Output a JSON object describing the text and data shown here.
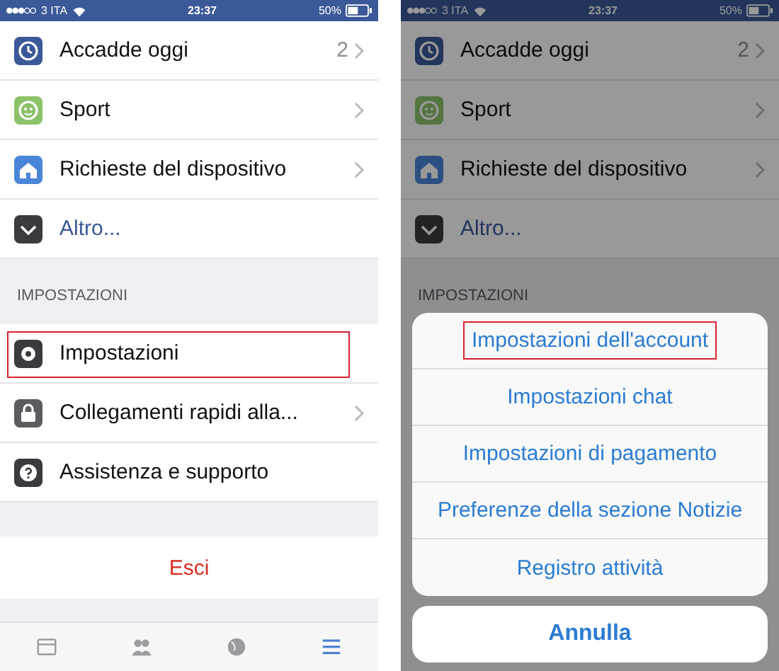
{
  "screens": [
    {
      "status_bar": {
        "carrier": "3 ITA",
        "time": "23:37",
        "battery": "50%"
      },
      "menu_items": [
        {
          "kind": "clock",
          "label": "Accadde oggi",
          "count": "2",
          "has_arrow": true,
          "highlighted": false
        },
        {
          "kind": "sport",
          "label": "Sport",
          "has_arrow": true,
          "highlighted": false
        },
        {
          "kind": "device",
          "label": "Richieste del dispositivo",
          "has_arrow": true,
          "highlighted": false
        },
        {
          "kind": "more",
          "label": "Altro...",
          "has_arrow": false,
          "highlighted": false
        }
      ],
      "section_header": "IMPOSTAZIONI",
      "settings_items": [
        {
          "kind": "gear",
          "label": "Impostazioni",
          "has_arrow": false,
          "highlighted": true
        },
        {
          "kind": "lock",
          "label": "Collegamenti rapidi alla...",
          "has_arrow": true,
          "highlighted": false
        },
        {
          "kind": "help",
          "label": "Assistenza e supporto",
          "has_arrow": false,
          "highlighted": false
        }
      ],
      "logout": "Esci",
      "tab_bar": [
        {
          "kind": "news",
          "selected": false
        },
        {
          "kind": "friends",
          "selected": false
        },
        {
          "kind": "globe",
          "selected": false
        },
        {
          "kind": "menu",
          "selected": true
        }
      ]
    },
    {
      "status_bar": {
        "carrier": "3 ITA",
        "time": "23:37",
        "battery": "50%"
      },
      "menu_items": [
        {
          "kind": "clock",
          "label": "Accadde oggi",
          "count": "2",
          "has_arrow": true,
          "highlighted": false
        },
        {
          "kind": "sport",
          "label": "Sport",
          "has_arrow": true,
          "highlighted": false
        },
        {
          "kind": "device",
          "label": "Richieste del dispositivo",
          "has_arrow": true,
          "highlighted": false
        },
        {
          "kind": "more",
          "label": "Altro...",
          "has_arrow": false,
          "highlighted": false
        }
      ],
      "section_header": "IMPOSTAZIONI",
      "action_sheet": {
        "options": [
          {
            "label": "Impostazioni dell'account",
            "highlighted": true
          },
          {
            "label": "Impostazioni chat",
            "highlighted": false
          },
          {
            "label": "Impostazioni di pagamento",
            "highlighted": false
          },
          {
            "label": "Preferenze della sezione Notizie",
            "highlighted": false
          },
          {
            "label": "Registro attività",
            "highlighted": false
          }
        ],
        "cancel": "Annulla"
      }
    }
  ]
}
